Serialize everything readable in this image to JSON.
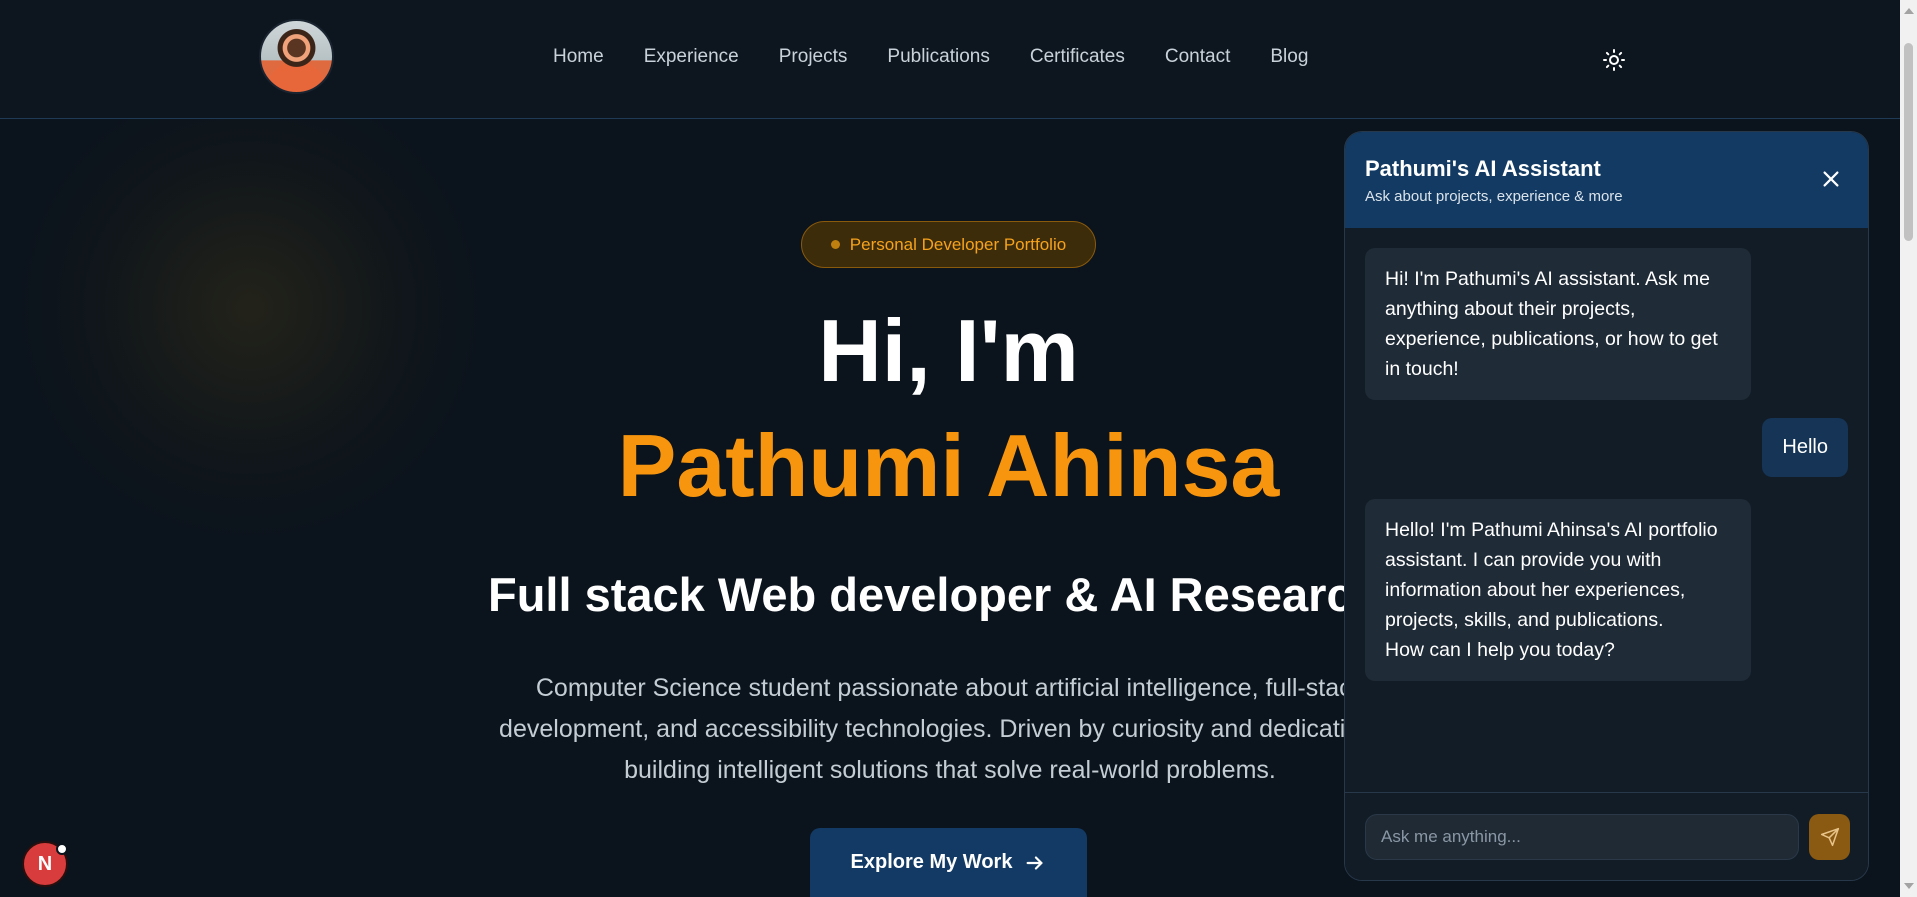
{
  "nav": {
    "items": [
      {
        "label": "Home"
      },
      {
        "label": "Experience"
      },
      {
        "label": "Projects"
      },
      {
        "label": "Publications"
      },
      {
        "label": "Certificates"
      },
      {
        "label": "Contact"
      },
      {
        "label": "Blog"
      }
    ],
    "theme_icon": "sun-icon"
  },
  "hero": {
    "badge": "Personal Developer Portfolio",
    "greeting": "Hi, I'm",
    "name": "Pathumi Ahinsa",
    "subtitle": "Full stack Web developer & AI Researcher",
    "description": "Computer Science student passionate about artificial intelligence, full-stack development, and accessibility technologies. Driven by curiosity and dedication to building intelligent solutions that solve real-world problems.",
    "cta_label": "Explore My Work"
  },
  "chat": {
    "title": "Pathumi's AI Assistant",
    "subtitle": "Ask about projects, experience & more",
    "messages": [
      {
        "role": "assistant",
        "text": "Hi! I'm Pathumi's AI assistant. Ask me anything about their projects, experience, publications, or how to get in touch!"
      },
      {
        "role": "user",
        "text": "Hello"
      },
      {
        "role": "assistant",
        "text": "Hello! I'm Pathumi Ahinsa's AI portfolio assistant. I can provide you with information about her experiences, projects, skills, and publications.\nHow can I help you today?"
      }
    ],
    "input_placeholder": "Ask me anything..."
  },
  "dev_badge": {
    "label": "N"
  },
  "colors": {
    "accent": "#f7950e",
    "primary": "#123a64",
    "background": "#0b131c"
  }
}
